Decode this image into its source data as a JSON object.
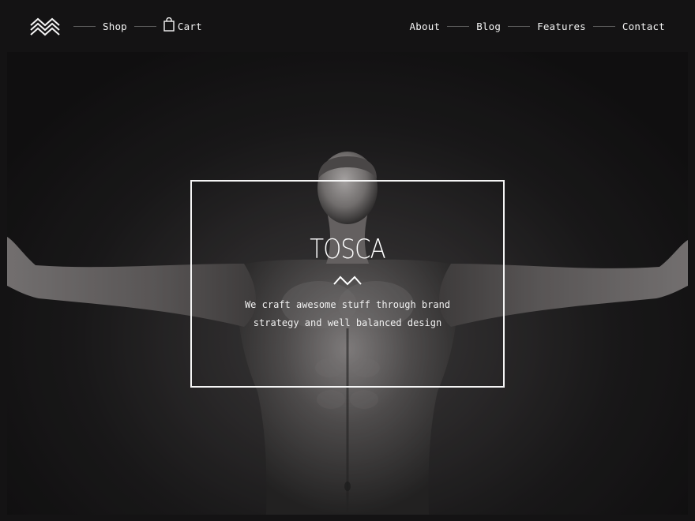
{
  "header": {
    "logo_icon": "zigzag-chevrons-logo",
    "nav_left": [
      {
        "label": "Shop"
      },
      {
        "label": "Cart",
        "icon": "shopping-bag-icon"
      }
    ],
    "nav_right": [
      {
        "label": "About"
      },
      {
        "label": "Blog"
      },
      {
        "label": "Features"
      },
      {
        "label": "Contact"
      }
    ]
  },
  "hero": {
    "brand_name": "TOSCA",
    "brand_mark_icon": "zigzag-mark-icon",
    "tagline_line1": "We craft awesome stuff through brand",
    "tagline_line2": "strategy and well balanced design",
    "image_description_icon": "hero-photo-man-arms-outstretched"
  },
  "colors": {
    "background": "#141314",
    "text": "#f4f4f4",
    "separator": "#5a5a5a"
  }
}
